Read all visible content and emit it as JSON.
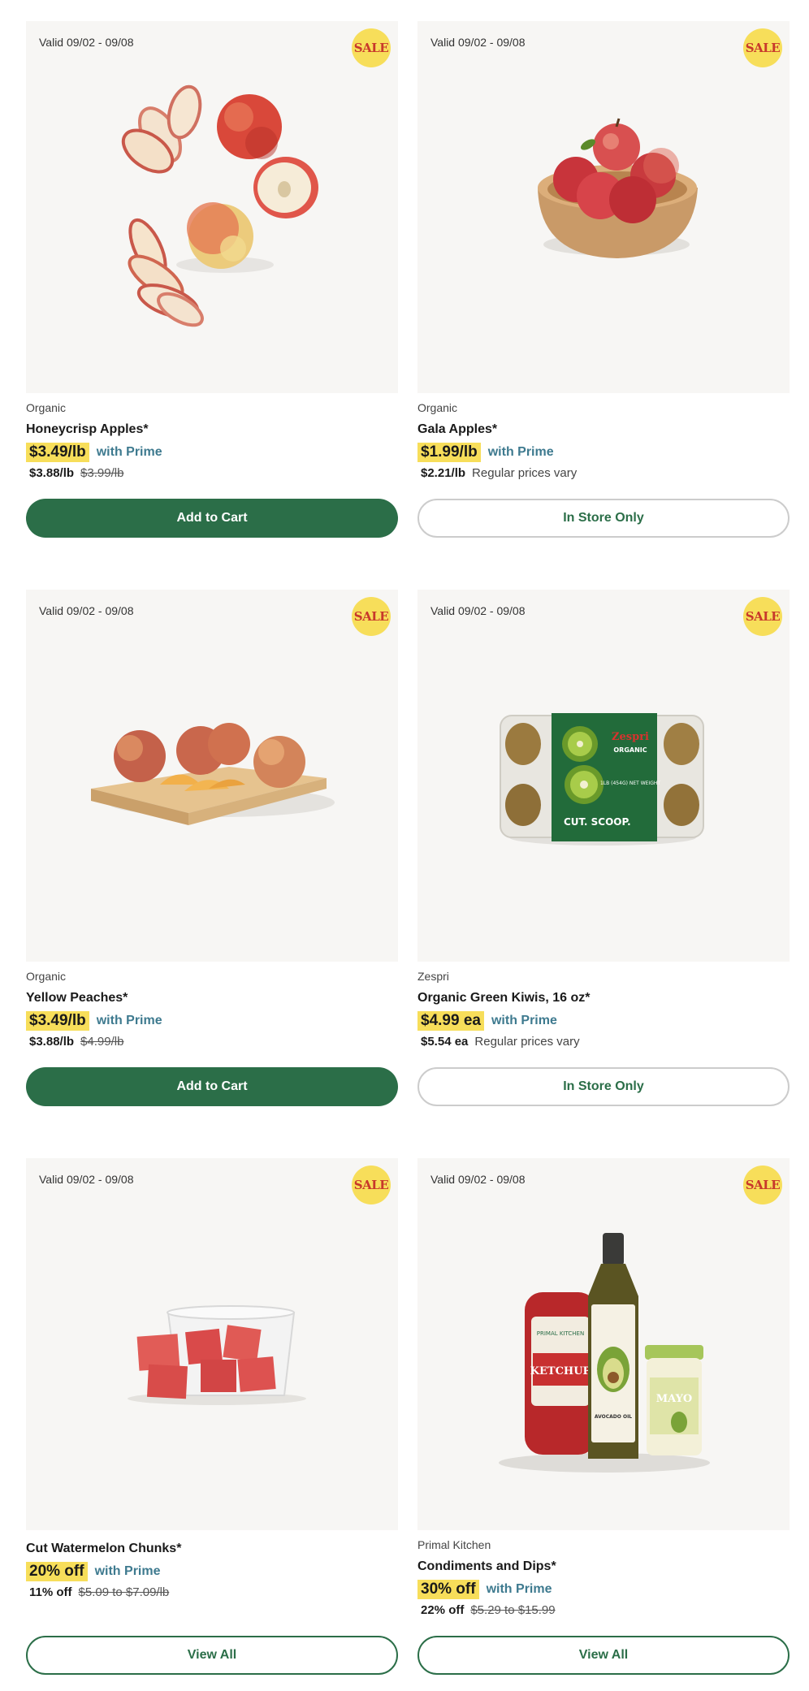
{
  "products": [
    {
      "valid": "Valid 09/02 - 09/08",
      "sale_badge": "SALE",
      "brand": "Organic",
      "title": "Honeycrisp Apples*",
      "sale_price": "$3.49/lb",
      "prime_label": "with Prime",
      "regular_price": "$3.88/lb",
      "strike_price": "$3.99/lb",
      "note": "",
      "button": "Add to Cart"
    },
    {
      "valid": "Valid 09/02 - 09/08",
      "sale_badge": "SALE",
      "brand": "Organic",
      "title": "Gala Apples*",
      "sale_price": "$1.99/lb",
      "prime_label": "with Prime",
      "regular_price": "$2.21/lb",
      "strike_price": "",
      "note": "Regular prices vary",
      "button": "In Store Only"
    },
    {
      "valid": "Valid 09/02 - 09/08",
      "sale_badge": "SALE",
      "brand": "Organic",
      "title": "Yellow Peaches*",
      "sale_price": "$3.49/lb",
      "prime_label": "with Prime",
      "regular_price": "$3.88/lb",
      "strike_price": "$4.99/lb",
      "note": "",
      "button": "Add to Cart"
    },
    {
      "valid": "Valid 09/02 - 09/08",
      "sale_badge": "SALE",
      "brand": "Zespri",
      "title": "Organic Green Kiwis, 16 oz*",
      "sale_price": "$4.99 ea",
      "prime_label": "with Prime",
      "regular_price": "$5.54 ea",
      "strike_price": "",
      "note": "Regular prices vary",
      "button": "In Store Only"
    },
    {
      "valid": "Valid 09/02 - 09/08",
      "sale_badge": "SALE",
      "brand": "",
      "title": "Cut Watermelon Chunks*",
      "sale_price": "20% off",
      "prime_label": "with Prime",
      "regular_price": "11% off",
      "strike_price": "$5.09 to $7.09/lb",
      "note": "",
      "button": "View All"
    },
    {
      "valid": "Valid 09/02 - 09/08",
      "sale_badge": "SALE",
      "brand": "Primal Kitchen",
      "title": "Condiments and Dips*",
      "sale_price": "30% off",
      "prime_label": "with Prime",
      "regular_price": "22% off",
      "strike_price": "$5.29 to $15.99",
      "note": "",
      "button": "View All"
    }
  ],
  "product_labels": {
    "kiwi_brand": "Zespri",
    "kiwi_organic": "ORGANIC",
    "kiwi_weight": "1LB (454G) NET WEIGHT",
    "kiwi_tag": "CUT. SCOOP.",
    "ketchup_brand": "PRIMAL KITCHEN",
    "ketchup_label": "KETCHUP",
    "oil_label": "AVOCADO OIL",
    "mayo_label": "MAYO"
  },
  "colors": {
    "sale_yellow": "#f7de5a",
    "sale_red": "#c8382b",
    "brand_green": "#2b6e48",
    "prime_blue": "#3e7a8f",
    "image_bg": "#f7f6f4"
  }
}
